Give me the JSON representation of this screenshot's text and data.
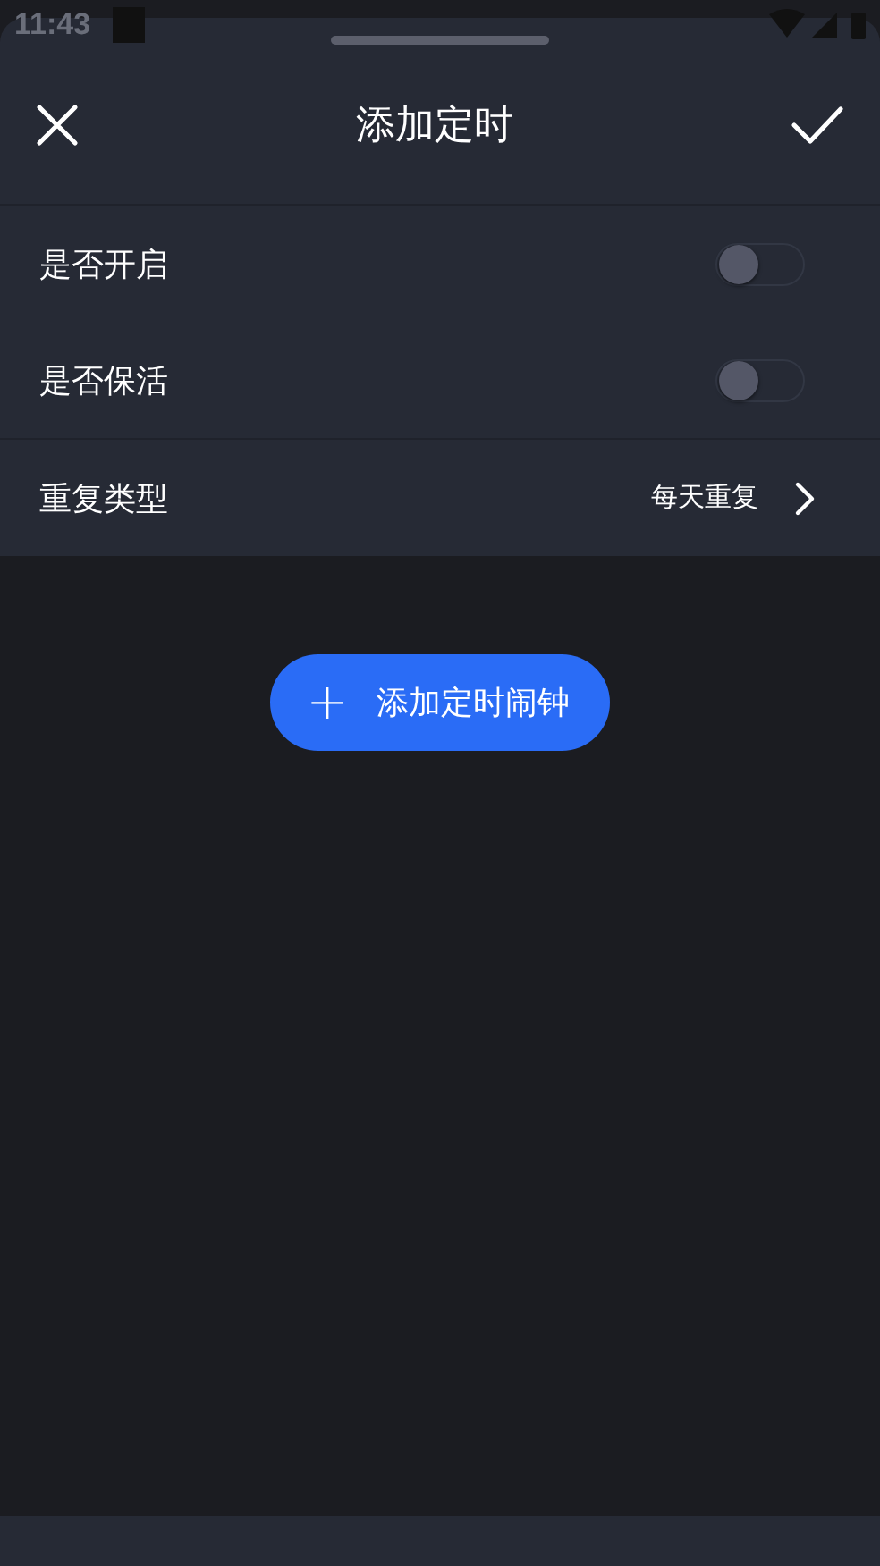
{
  "status_bar": {
    "time": "11:43"
  },
  "header": {
    "title": "添加定时"
  },
  "settings": [
    {
      "kind": "toggle",
      "label": "是否开启",
      "on": false
    },
    {
      "kind": "toggle",
      "label": "是否保活",
      "on": false
    },
    {
      "kind": "link",
      "label": "重复类型",
      "value": "每天重复"
    }
  ],
  "add_button": {
    "icon": "+",
    "label": "添加定时闹钟"
  }
}
